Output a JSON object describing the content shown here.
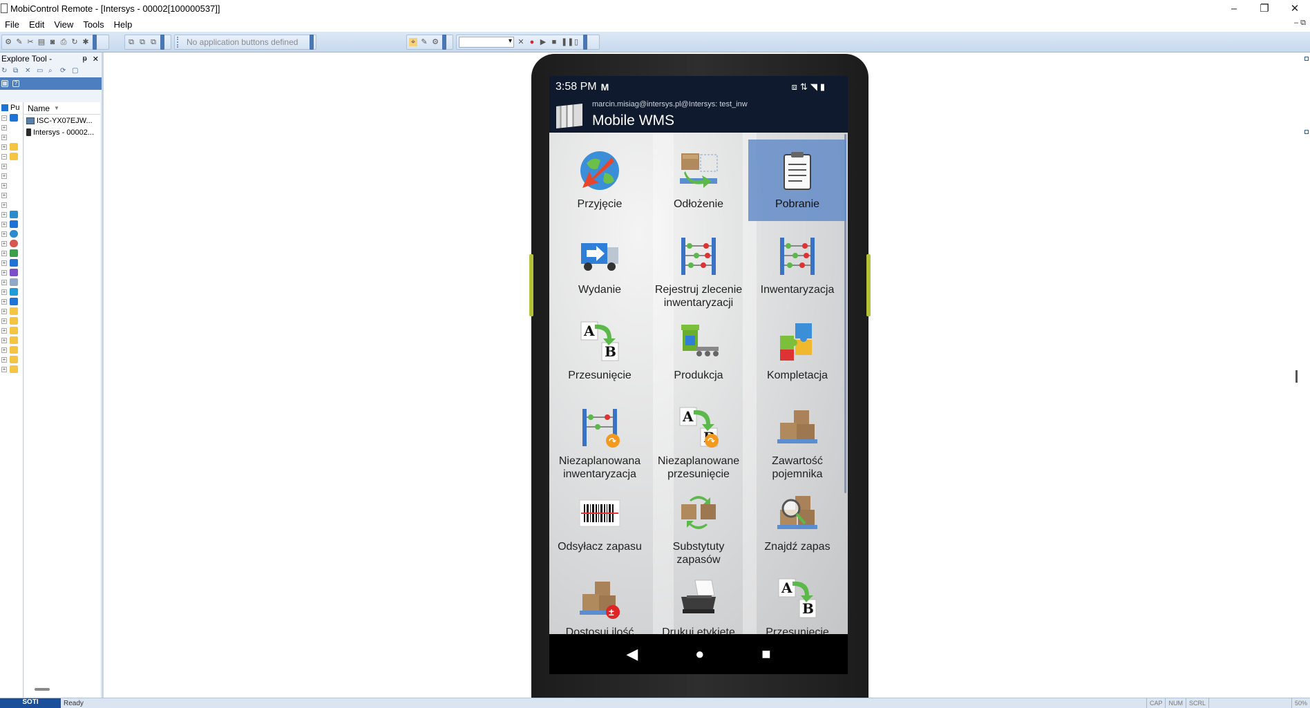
{
  "window": {
    "title": "MobiControl Remote - [Intersys - 00002[100000537]]",
    "minimize": "–",
    "restore": "❐",
    "close": "✕"
  },
  "menu": {
    "items": [
      "File",
      "Edit",
      "View",
      "Tools",
      "Help"
    ],
    "mdi_controls": "– ⧉"
  },
  "toolbar": {
    "app_buttons_placeholder": "No application buttons defined"
  },
  "explore": {
    "title": "Explore Tool -",
    "pin": "ᵽ",
    "close": "✕",
    "root_label": "Pu",
    "column_name": "Name",
    "rows": [
      {
        "label": "ISC-YX07EJW..."
      },
      {
        "label": "Intersys - 00002..."
      }
    ]
  },
  "device": {
    "status": {
      "time": "3:58 PM",
      "time_icon": "M"
    },
    "app": {
      "user": "marcin.misiag@intersys.pl@Intersys: test_inw",
      "title": "Mobile WMS"
    },
    "tiles": [
      {
        "label": "Przyjęcie",
        "icon": "globe-arrow-icon",
        "selected": false
      },
      {
        "label": "Odłożenie",
        "icon": "box-putaway-icon",
        "selected": false
      },
      {
        "label": "Pobranie",
        "icon": "clipboard-icon",
        "selected": true
      },
      {
        "label": "Wydanie",
        "icon": "truck-icon",
        "selected": false
      },
      {
        "label": "Rejestruj zlecenie inwentaryzacji",
        "icon": "abacus-icon",
        "selected": false
      },
      {
        "label": "Inwentaryzacja",
        "icon": "abacus-icon",
        "selected": false
      },
      {
        "label": "Przesunięcie",
        "icon": "a-to-b-icon",
        "selected": false
      },
      {
        "label": "Produkcja",
        "icon": "production-icon",
        "selected": false
      },
      {
        "label": "Kompletacja",
        "icon": "puzzle-icon",
        "selected": false
      },
      {
        "label": "Niezaplanowana inwentaryzacja",
        "icon": "abacus-unplanned-icon",
        "selected": false
      },
      {
        "label": "Niezaplanowane przesunięcie",
        "icon": "a-to-b-unplanned-icon",
        "selected": false
      },
      {
        "label": "Zawartość pojemnika",
        "icon": "boxes-icon",
        "selected": false
      },
      {
        "label": "Odsyłacz zapasu",
        "icon": "barcode-icon",
        "selected": false
      },
      {
        "label": "Substytuty zapasów",
        "icon": "boxes-swap-icon",
        "selected": false
      },
      {
        "label": "Znajdź zapas",
        "icon": "boxes-search-icon",
        "selected": false
      },
      {
        "label": "Dostosuj ilość",
        "icon": "boxes-adjust-icon",
        "selected": false
      },
      {
        "label": "Drukuj etykietę",
        "icon": "printer-icon",
        "selected": false
      },
      {
        "label": "Przesunięcie",
        "icon": "a-to-b-icon",
        "selected": false
      }
    ]
  },
  "statusbar": {
    "brand": "SOTI",
    "status": "Ready",
    "cap": "CAP",
    "num": "NUM",
    "scrl": "SCRL",
    "zoom": "50%"
  },
  "colors": {
    "app_header": "#101a2e",
    "selected_tile": "#648cc8",
    "toolbar": "#c7d9ee"
  }
}
